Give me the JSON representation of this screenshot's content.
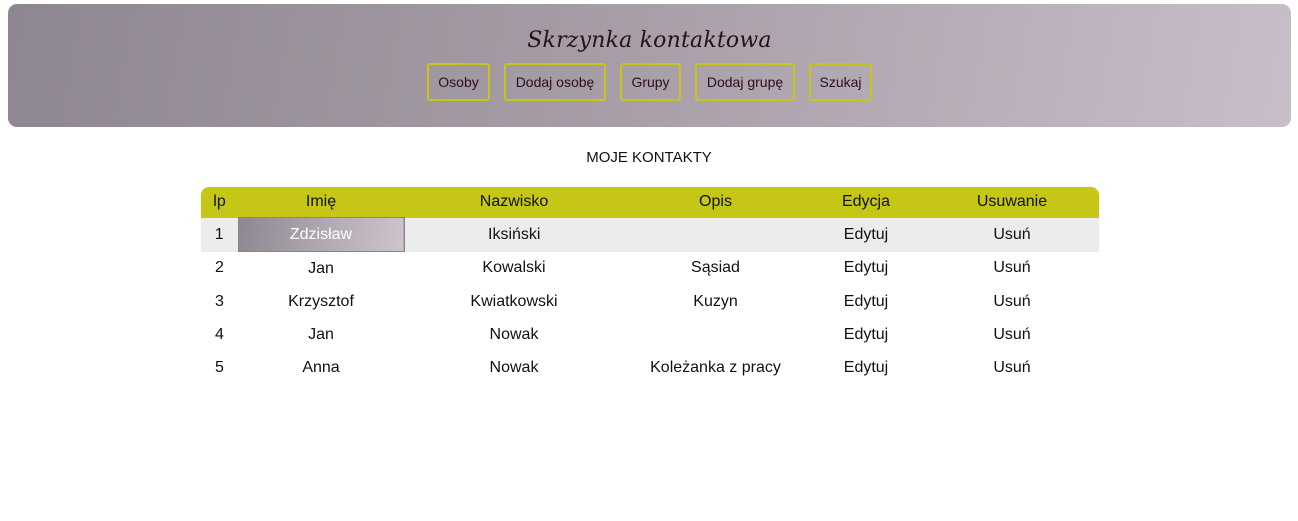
{
  "header": {
    "title": "Skrzynka kontaktowa",
    "nav": [
      "Osoby",
      "Dodaj osobę",
      "Grupy",
      "Dodaj grupę",
      "Szukaj"
    ]
  },
  "main": {
    "section_title": "MOJE KONTAKTY",
    "table": {
      "columns": [
        "lp",
        "Imię",
        "Nazwisko",
        "Opis",
        "Edycja",
        "Usuwanie"
      ],
      "rows": [
        {
          "lp": "1",
          "imie": "Zdzisław",
          "nazwisko": "Iksiński",
          "opis": "",
          "edycja": "Edytuj",
          "usun": "Usuń"
        },
        {
          "lp": "2",
          "imie": "Jan",
          "nazwisko": "Kowalski",
          "opis": "Sąsiad",
          "edycja": "Edytuj",
          "usun": "Usuń"
        },
        {
          "lp": "3",
          "imie": "Krzysztof",
          "nazwisko": "Kwiatkowski",
          "opis": "Kuzyn",
          "edycja": "Edytuj",
          "usun": "Usuń"
        },
        {
          "lp": "4",
          "imie": "Jan",
          "nazwisko": "Nowak",
          "opis": "",
          "edycja": "Edytuj",
          "usun": "Usuń"
        },
        {
          "lp": "5",
          "imie": "Anna",
          "nazwisko": "Nowak",
          "opis": "Koleżanka z pracy",
          "edycja": "Edytuj",
          "usun": "Usuń"
        }
      ]
    }
  },
  "colors": {
    "accent": "#c5c616",
    "header_gradient_start": "#8e8690",
    "header_gradient_end": "#c8bec9",
    "title_color": "#2a0f1c",
    "row_highlight": "#ececec"
  }
}
